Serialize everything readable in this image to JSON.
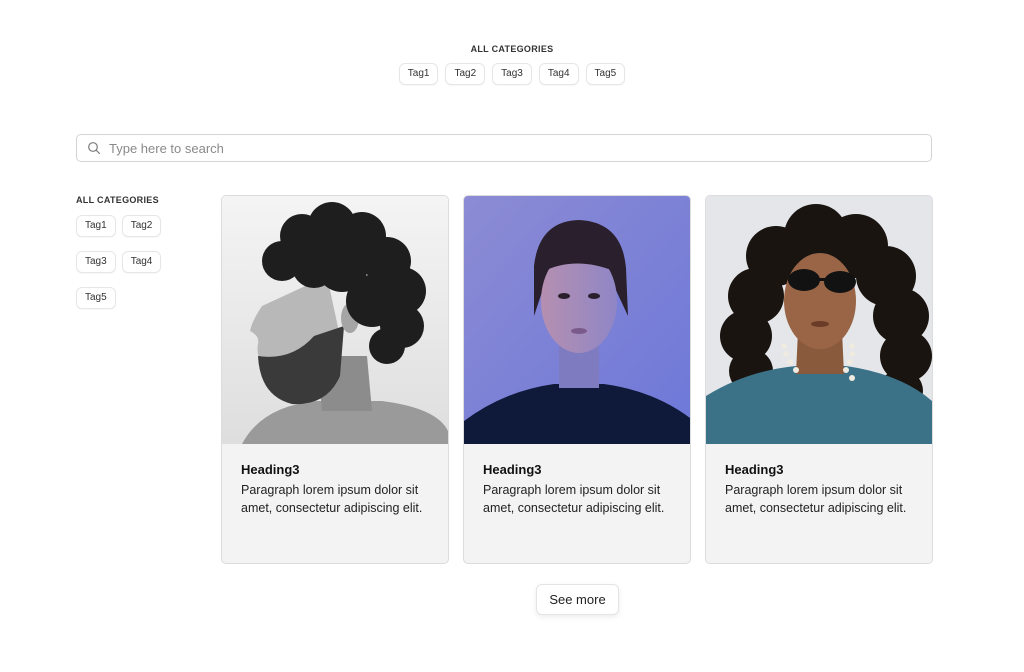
{
  "top_filter": {
    "label": "ALL CATEGORIES",
    "tags": [
      "Tag1",
      "Tag2",
      "Tag3",
      "Tag4",
      "Tag5"
    ]
  },
  "search": {
    "placeholder": "Type here to search",
    "value": "",
    "icon": "search-icon"
  },
  "side_filter": {
    "label": "ALL CATEGORIES",
    "tags": [
      "Tag1",
      "Tag2",
      "Tag3",
      "Tag4",
      "Tag5"
    ]
  },
  "cards": [
    {
      "heading": "Heading3",
      "text": "Paragraph lorem ipsum dolor sit amet, consectetur adipiscing elit.",
      "image": "portrait-man-curly-beard"
    },
    {
      "heading": "Heading3",
      "text": "Paragraph lorem ipsum dolor sit amet, consectetur adipiscing elit.",
      "image": "portrait-woman-blue-light"
    },
    {
      "heading": "Heading3",
      "text": "Paragraph lorem ipsum dolor sit amet, consectetur adipiscing elit.",
      "image": "portrait-man-sunglasses"
    }
  ],
  "see_more_label": "See more",
  "colors": {
    "card_bg": "#f3f3f3",
    "border": "#dcdcdc",
    "text": "#111111"
  }
}
